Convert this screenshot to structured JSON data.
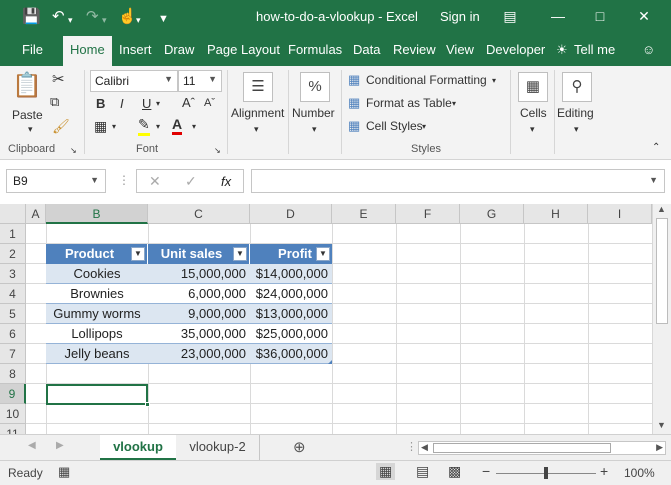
{
  "app": {
    "title": "how-to-do-a-vlookup - Excel",
    "signin": "Sign in",
    "tell_me": "Tell me"
  },
  "tabs": [
    "File",
    "Home",
    "Insert",
    "Draw",
    "Page Layout",
    "Formulas",
    "Data",
    "Review",
    "View",
    "Developer"
  ],
  "ribbon": {
    "clipboard": {
      "label": "Clipboard",
      "paste": "Paste"
    },
    "font": {
      "label": "Font",
      "name": "Calibri",
      "size": "11",
      "bold": "B",
      "italic": "I",
      "underline": "U"
    },
    "alignment": {
      "label": "Alignment"
    },
    "number": {
      "label": "Number",
      "symbol": "%"
    },
    "styles": {
      "label": "Styles",
      "conditional": "Conditional Formatting",
      "format_table": "Format as Table",
      "cell_styles": "Cell Styles"
    },
    "cells": {
      "label": "Cells"
    },
    "editing": {
      "label": "Editing"
    }
  },
  "formula_bar": {
    "name_box": "B9",
    "fx": "fx",
    "value": ""
  },
  "grid": {
    "columns": [
      "A",
      "B",
      "C",
      "D",
      "E",
      "F",
      "G",
      "H",
      "I"
    ],
    "rows": [
      "1",
      "2",
      "3",
      "4",
      "5",
      "6",
      "7",
      "8",
      "9",
      "10",
      "11"
    ],
    "selected_cell": "B9",
    "table": {
      "headers": [
        "Product",
        "Unit sales",
        "Profit"
      ],
      "rows": [
        [
          "Cookies",
          "15,000,000",
          "$14,000,000"
        ],
        [
          "Brownies",
          "6,000,000",
          "$24,000,000"
        ],
        [
          "Gummy worms",
          "9,000,000",
          "$13,000,000"
        ],
        [
          "Lollipops",
          "35,000,000",
          "$25,000,000"
        ],
        [
          "Jelly beans",
          "23,000,000",
          "$36,000,000"
        ]
      ]
    }
  },
  "sheets": [
    "vlookup",
    "vlookup-2"
  ],
  "active_sheet": "vlookup",
  "status": {
    "ready": "Ready",
    "zoom": "100%"
  },
  "colors": {
    "excel_green": "#217346",
    "table_header": "#4f81bd",
    "table_band": "#dce6f1"
  }
}
